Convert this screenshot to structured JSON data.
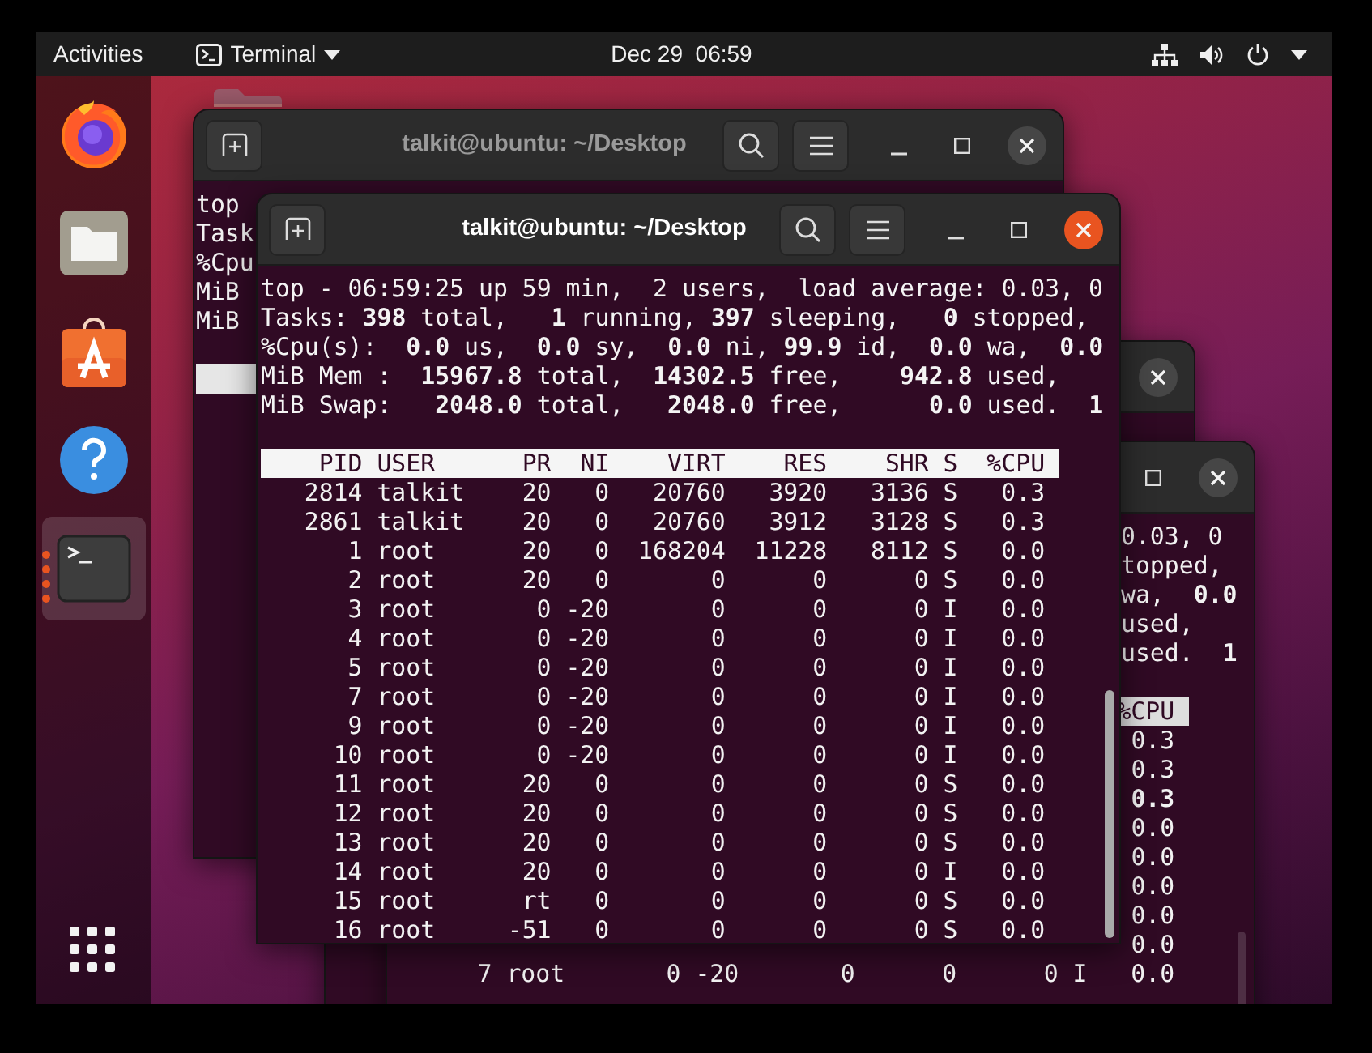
{
  "top_bar": {
    "activities": "Activities",
    "app_menu": "Terminal",
    "clock": "Dec 29  06:59"
  },
  "dock": {
    "items": [
      {
        "kind": "firefox",
        "selected": false,
        "running": false
      },
      {
        "kind": "files",
        "selected": false,
        "running": false
      },
      {
        "kind": "software",
        "selected": false,
        "running": false
      },
      {
        "kind": "help",
        "selected": false,
        "running": false
      },
      {
        "kind": "terminal",
        "selected": true,
        "running": true
      }
    ]
  },
  "terminal_back_left": {
    "title": "talkit@ubuntu: ~/Desktop",
    "focused": false,
    "lines": [
      "top",
      "Task",
      "%Cpu",
      "MiB",
      "MiB"
    ]
  },
  "terminal_back_right": {
    "focused": false
  },
  "terminal_middle": {
    "focused": false,
    "lines": [
      "0.03, 0",
      "topped,",
      "wa,  **0.0**",
      "used,",
      "used.  **1**"
    ],
    "cpu_header": "%CPU",
    "cpu_values": [
      {
        "text": "0.3",
        "bold": false
      },
      {
        "text": "0.3",
        "bold": false
      },
      {
        "text": "0.3",
        "bold": true
      },
      {
        "text": "0.0",
        "bold": false
      },
      {
        "text": "0.0",
        "bold": false
      },
      {
        "text": "0.0",
        "bold": false
      },
      {
        "text": "0.0",
        "bold": false
      },
      {
        "text": "0.0",
        "bold": false
      }
    ],
    "process_rows": [
      [
        "7",
        "root",
        "0",
        "-20",
        "0",
        "0",
        "0",
        "I",
        "0.0"
      ]
    ]
  },
  "terminal_front": {
    "title": "talkit@ubuntu: ~/Desktop",
    "focused": true,
    "summary": [
      "top - 06:59:25 up 59 min,  2 users,  load average: 0.03, 0",
      "Tasks: **398** total,   **1** running, **397** sleeping,   **0** stopped,",
      "%Cpu(s):  **0.0** us,  **0.0** sy,  **0.0** ni, **99.9** id,  **0.0** wa,  **0.0**",
      "MiB Mem :  **15967.8** total,  **14302.5** free,    **942.8** used,",
      "MiB Swap:   **2048.0** total,   **2048.0** free,      **0.0** used.  **1**"
    ],
    "columns": [
      "PID",
      "USER",
      "PR",
      "NI",
      "VIRT",
      "RES",
      "SHR",
      "S",
      "%CPU"
    ],
    "rows": [
      [
        "2814",
        "talkit",
        "20",
        "0",
        "20760",
        "3920",
        "3136",
        "S",
        "0.3"
      ],
      [
        "2861",
        "talkit",
        "20",
        "0",
        "20760",
        "3912",
        "3128",
        "S",
        "0.3"
      ],
      [
        "1",
        "root",
        "20",
        "0",
        "168204",
        "11228",
        "8112",
        "S",
        "0.0"
      ],
      [
        "2",
        "root",
        "20",
        "0",
        "0",
        "0",
        "0",
        "S",
        "0.0"
      ],
      [
        "3",
        "root",
        "0",
        "-20",
        "0",
        "0",
        "0",
        "I",
        "0.0"
      ],
      [
        "4",
        "root",
        "0",
        "-20",
        "0",
        "0",
        "0",
        "I",
        "0.0"
      ],
      [
        "5",
        "root",
        "0",
        "-20",
        "0",
        "0",
        "0",
        "I",
        "0.0"
      ],
      [
        "7",
        "root",
        "0",
        "-20",
        "0",
        "0",
        "0",
        "I",
        "0.0"
      ],
      [
        "9",
        "root",
        "0",
        "-20",
        "0",
        "0",
        "0",
        "I",
        "0.0"
      ],
      [
        "10",
        "root",
        "0",
        "-20",
        "0",
        "0",
        "0",
        "I",
        "0.0"
      ],
      [
        "11",
        "root",
        "20",
        "0",
        "0",
        "0",
        "0",
        "S",
        "0.0"
      ],
      [
        "12",
        "root",
        "20",
        "0",
        "0",
        "0",
        "0",
        "S",
        "0.0"
      ],
      [
        "13",
        "root",
        "20",
        "0",
        "0",
        "0",
        "0",
        "S",
        "0.0"
      ],
      [
        "14",
        "root",
        "20",
        "0",
        "0",
        "0",
        "0",
        "I",
        "0.0"
      ],
      [
        "15",
        "root",
        "rt",
        "0",
        "0",
        "0",
        "0",
        "S",
        "0.0"
      ],
      [
        "16",
        "root",
        "-51",
        "0",
        "0",
        "0",
        "0",
        "S",
        "0.0"
      ]
    ]
  }
}
